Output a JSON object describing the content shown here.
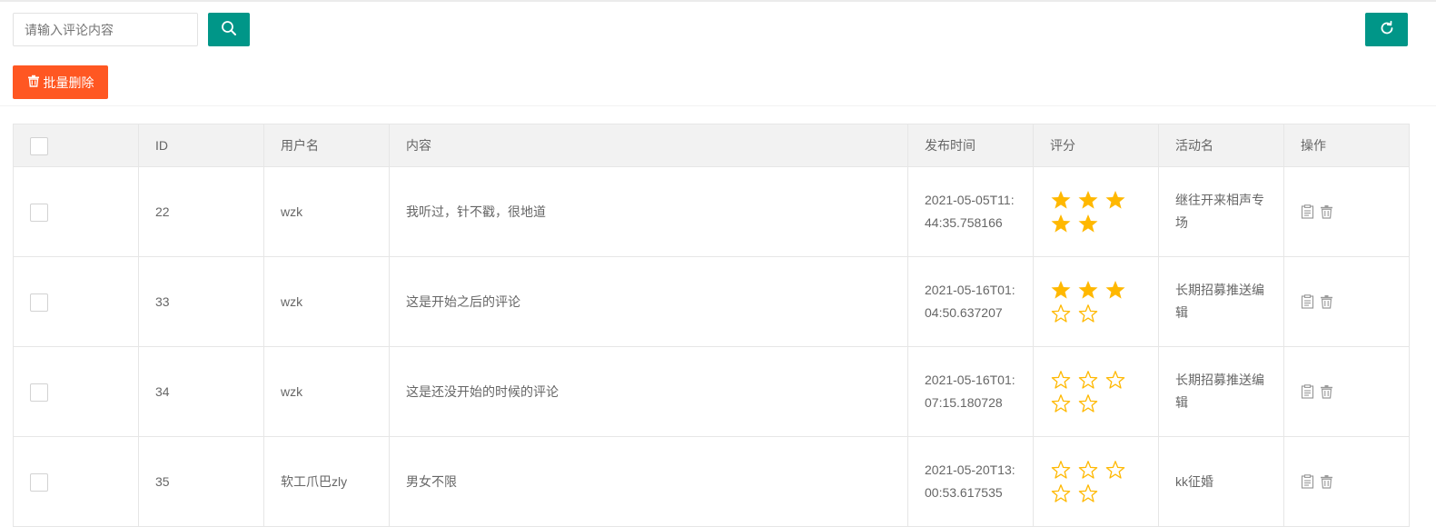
{
  "toolbar": {
    "search_placeholder": "请输入评论内容",
    "search_value": "",
    "batch_delete_label": "批量删除"
  },
  "colors": {
    "primary": "#009688",
    "danger": "#ff5722",
    "star": "#ffb800"
  },
  "icons": {
    "search": "search-icon",
    "refresh": "refresh-icon",
    "batch_delete": "trash-icon",
    "edit": "edit-icon",
    "delete": "delete-icon",
    "star_filled": "star-filled-icon",
    "star_empty": "star-empty-icon"
  },
  "table": {
    "headers": {
      "id": "ID",
      "username": "用户名",
      "content": "内容",
      "time": "发布时间",
      "rating": "评分",
      "activity": "活动名",
      "actions": "操作"
    },
    "rows": [
      {
        "id": "22",
        "username": "wzk",
        "content": "我听过，针不戳，很地道",
        "time": "2021-05-05T11:44:35.758166",
        "rating": 5,
        "rating_max": 5,
        "activity": "继往开来相声专场"
      },
      {
        "id": "33",
        "username": "wzk",
        "content": "这是开始之后的评论",
        "time": "2021-05-16T01:04:50.637207",
        "rating": 3,
        "rating_max": 5,
        "activity": "长期招募推送编辑"
      },
      {
        "id": "34",
        "username": "wzk",
        "content": "这是还没开始的时候的评论",
        "time": "2021-05-16T01:07:15.180728",
        "rating": 0,
        "rating_max": 5,
        "activity": "长期招募推送编辑"
      },
      {
        "id": "35",
        "username": "软工爪巴zly",
        "content": "男女不限",
        "time": "2021-05-20T13:00:53.617535",
        "rating": 0,
        "rating_max": 5,
        "activity": "kk征婚"
      }
    ]
  }
}
